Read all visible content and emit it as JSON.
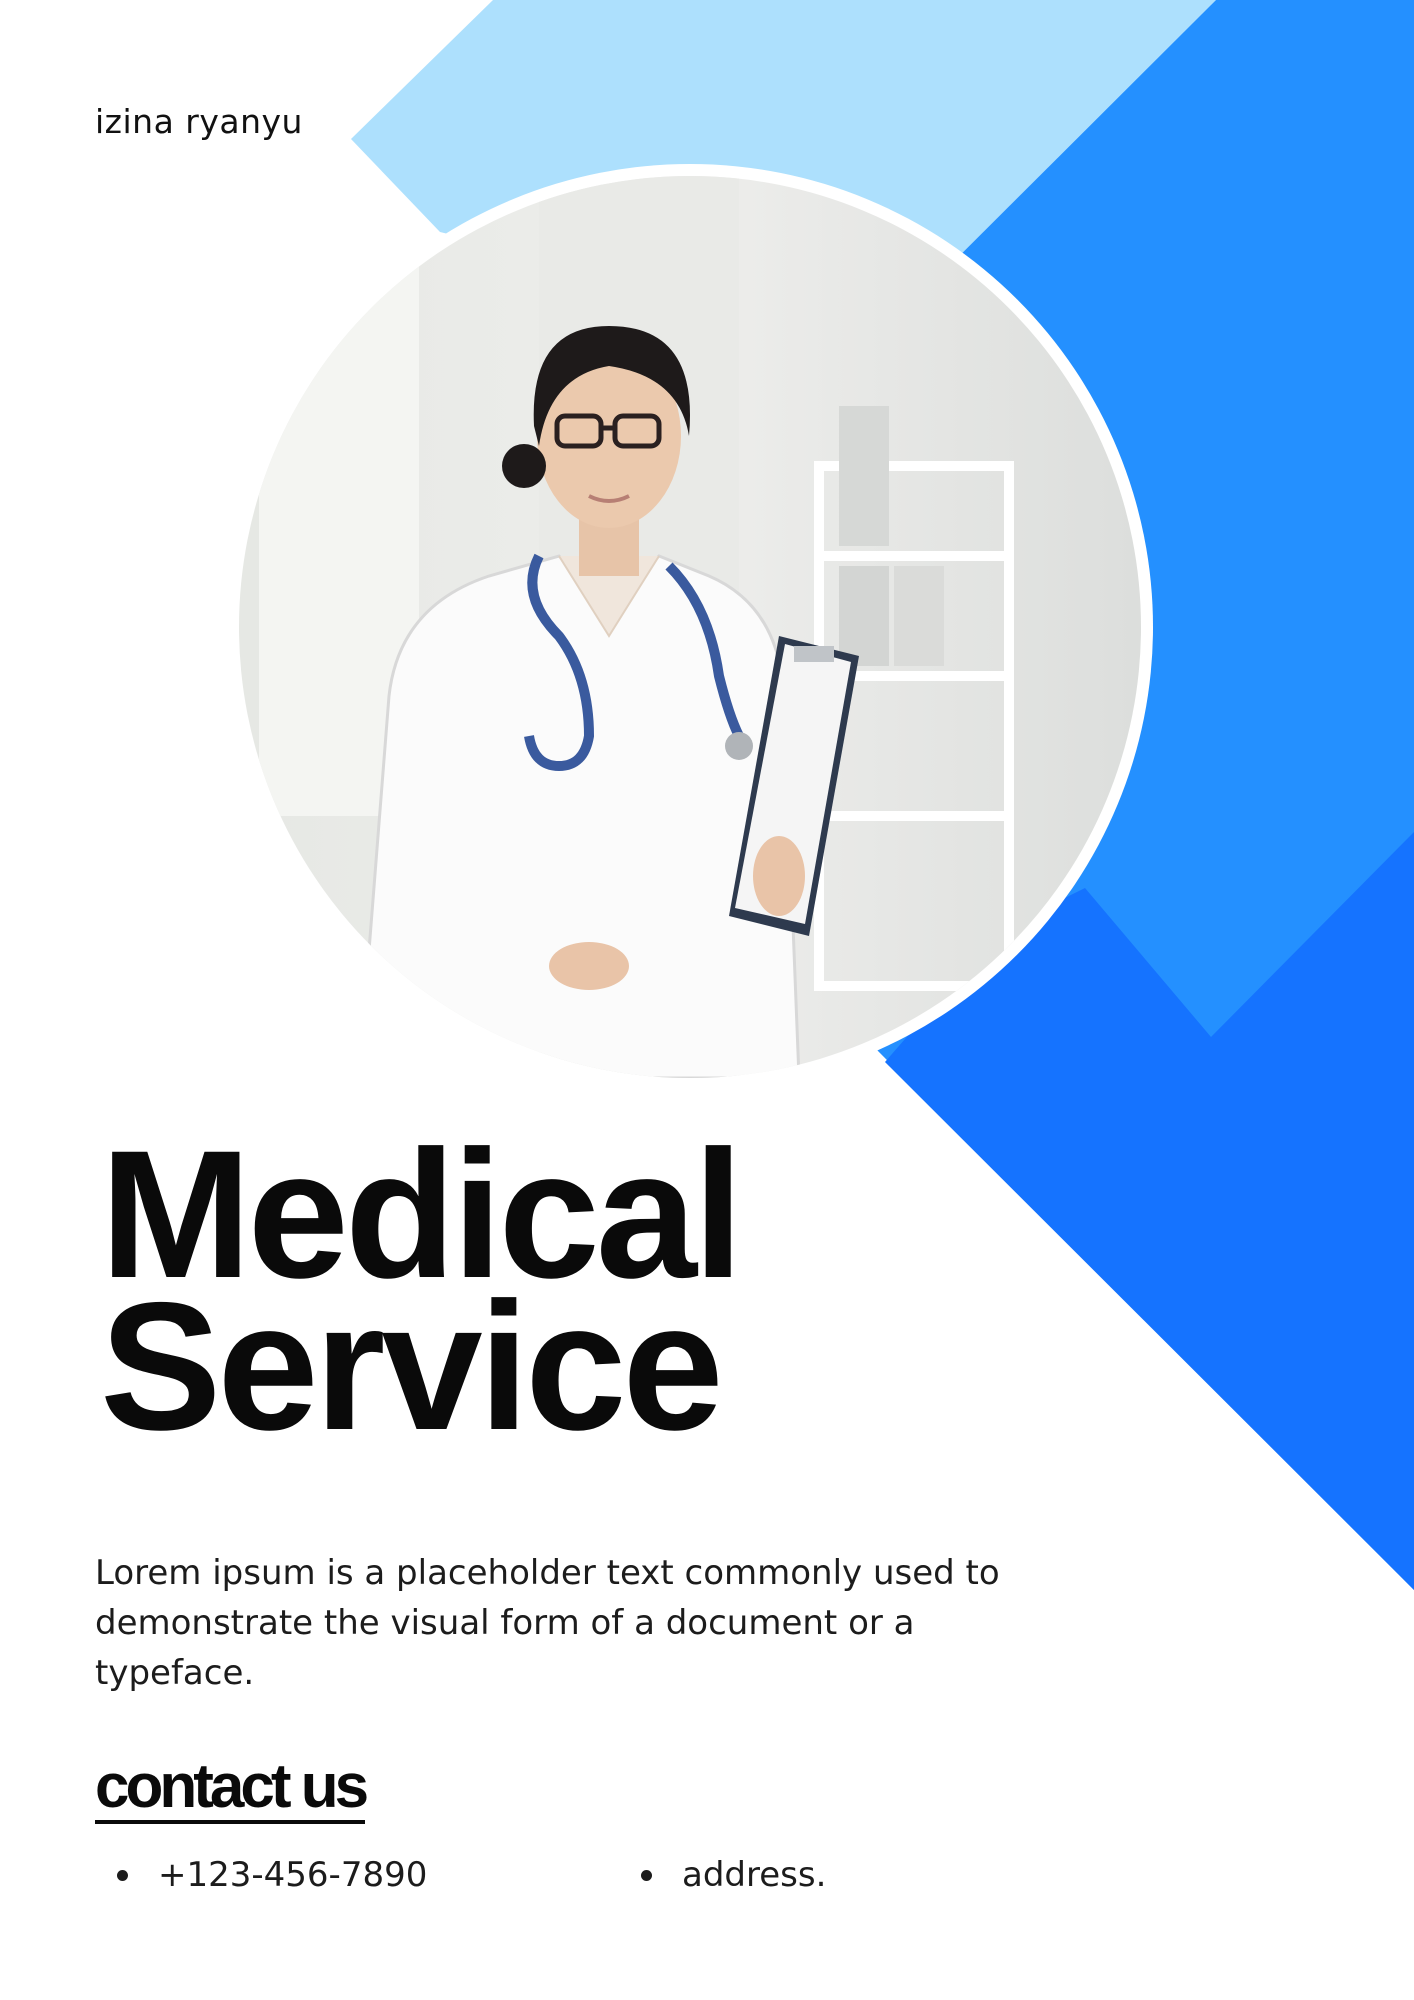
{
  "brand": {
    "name": "izina ryanyu"
  },
  "colors": {
    "light_blue": "#ADE0FD",
    "mid_blue": "#2490FF",
    "deep_blue": "#1573FF",
    "text": "#0A0A0A"
  },
  "photo": {
    "alt": "doctor-portrait"
  },
  "headline": {
    "line1": "Medical",
    "line2": "Service"
  },
  "description": "Lorem ipsum is a placeholder text commonly used to demonstrate the visual form of a document or a typeface.",
  "contact": {
    "heading": "contact us",
    "phone": "+123-456-7890",
    "address": "address."
  }
}
